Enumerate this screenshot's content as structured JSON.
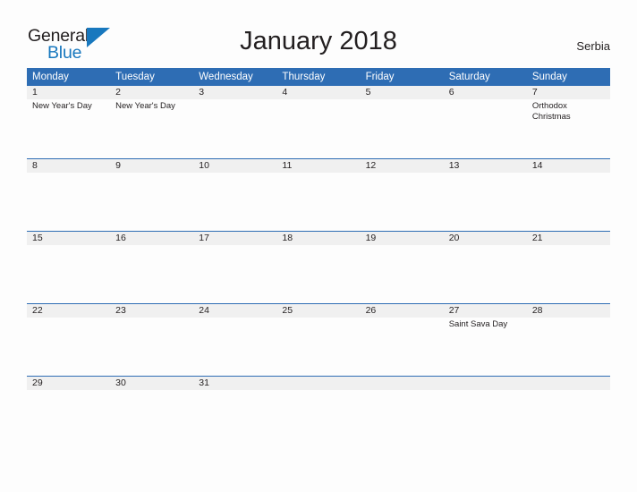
{
  "logo": {
    "word1": "General",
    "word2": "Blue",
    "flag_icon": "blue-flag-triangle",
    "color_dark": "#231f20",
    "color_blue": "#1878be"
  },
  "header": {
    "title": "January 2018",
    "country": "Serbia"
  },
  "theme": {
    "header_blue": "#2e6db4",
    "date_band_gray": "#f0f0f0",
    "page_background": "#fdfdfd",
    "text": "#231f20"
  },
  "calendar": {
    "weekdays": [
      "Monday",
      "Tuesday",
      "Wednesday",
      "Thursday",
      "Friday",
      "Saturday",
      "Sunday"
    ],
    "weeks": [
      [
        {
          "date": "1",
          "event": "New Year's Day"
        },
        {
          "date": "2",
          "event": "New Year's Day"
        },
        {
          "date": "3",
          "event": ""
        },
        {
          "date": "4",
          "event": ""
        },
        {
          "date": "5",
          "event": ""
        },
        {
          "date": "6",
          "event": ""
        },
        {
          "date": "7",
          "event": "Orthodox Christmas"
        }
      ],
      [
        {
          "date": "8",
          "event": ""
        },
        {
          "date": "9",
          "event": ""
        },
        {
          "date": "10",
          "event": ""
        },
        {
          "date": "11",
          "event": ""
        },
        {
          "date": "12",
          "event": ""
        },
        {
          "date": "13",
          "event": ""
        },
        {
          "date": "14",
          "event": ""
        }
      ],
      [
        {
          "date": "15",
          "event": ""
        },
        {
          "date": "16",
          "event": ""
        },
        {
          "date": "17",
          "event": ""
        },
        {
          "date": "18",
          "event": ""
        },
        {
          "date": "19",
          "event": ""
        },
        {
          "date": "20",
          "event": ""
        },
        {
          "date": "21",
          "event": ""
        }
      ],
      [
        {
          "date": "22",
          "event": ""
        },
        {
          "date": "23",
          "event": ""
        },
        {
          "date": "24",
          "event": ""
        },
        {
          "date": "25",
          "event": ""
        },
        {
          "date": "26",
          "event": ""
        },
        {
          "date": "27",
          "event": "Saint Sava Day"
        },
        {
          "date": "28",
          "event": ""
        }
      ],
      [
        {
          "date": "29",
          "event": ""
        },
        {
          "date": "30",
          "event": ""
        },
        {
          "date": "31",
          "event": ""
        },
        {
          "date": "",
          "event": ""
        },
        {
          "date": "",
          "event": ""
        },
        {
          "date": "",
          "event": ""
        },
        {
          "date": "",
          "event": ""
        }
      ]
    ]
  }
}
